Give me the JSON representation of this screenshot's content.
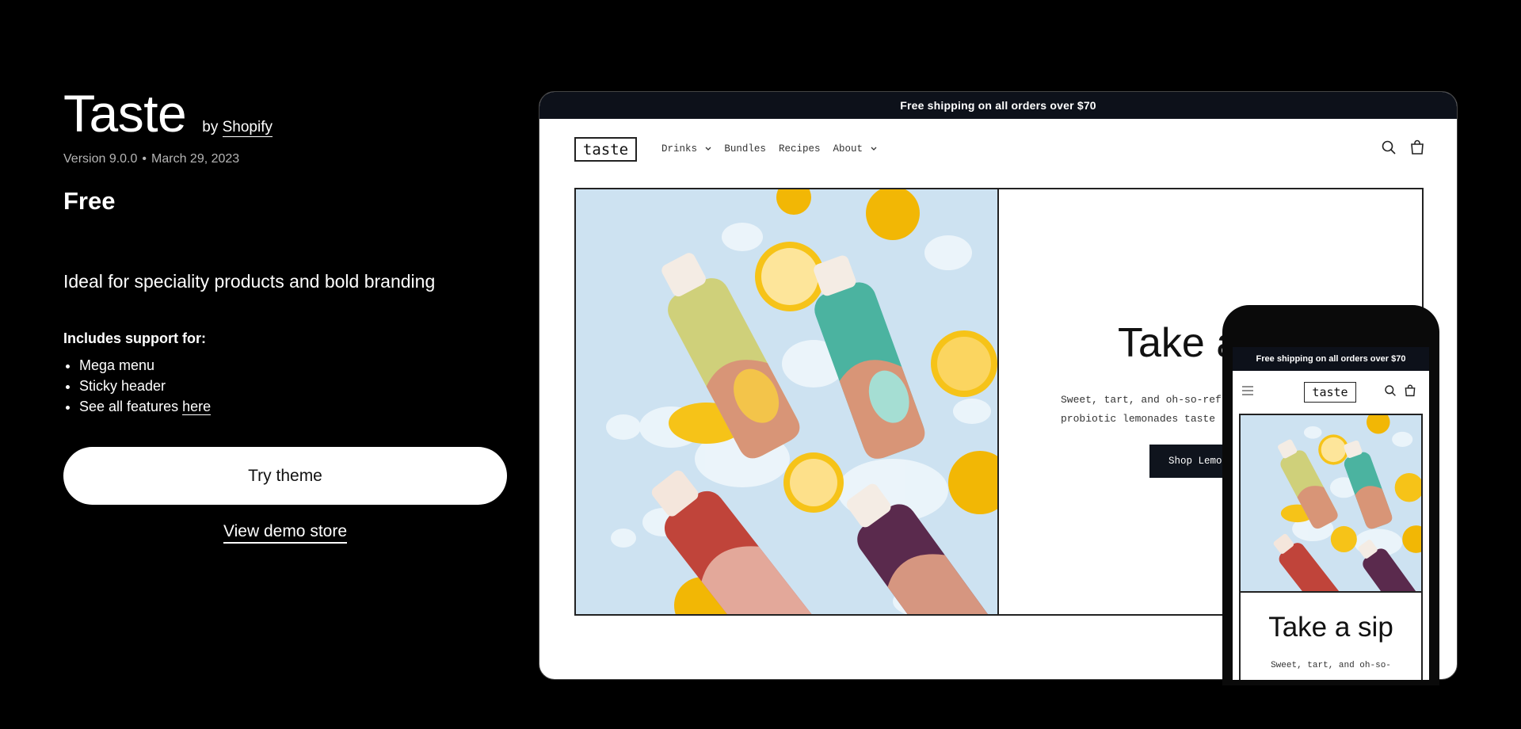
{
  "theme": {
    "name": "Taste",
    "by_prefix": "by",
    "by_link": "Shopify",
    "version": "Version 9.0.0",
    "date": "March 29, 2023",
    "dot": "•",
    "price": "Free",
    "tagline": "Ideal for speciality products and bold branding",
    "support_heading": "Includes support for:",
    "support_items": [
      "Mega menu",
      "Sticky header"
    ],
    "features_text": "See all features",
    "features_link": "here",
    "try_button": "Try theme",
    "demo_link": "View demo store"
  },
  "preview": {
    "announcement": "Free shipping on all orders over $70",
    "logo": "taste",
    "nav": [
      {
        "label": "Drinks",
        "has_dropdown": true
      },
      {
        "label": "Bundles",
        "has_dropdown": false
      },
      {
        "label": "Recipes",
        "has_dropdown": false
      },
      {
        "label": "About",
        "has_dropdown": true
      }
    ],
    "hero_title": "Take a",
    "hero_subtitle": "Sweet, tart, and oh-so-refr\nprobiotic lemonades taste l",
    "hero_cta": "Shop Lemon",
    "chevron": "⌄"
  },
  "mobile": {
    "announcement": "Free shipping on all orders over $70",
    "logo": "taste",
    "hero_title": "Take a sip",
    "hero_subtitle": "Sweet, tart, and oh-so-"
  },
  "colors": {
    "background": "#000000",
    "announcement_bar": "#0d111a",
    "button_dark": "#0f141d"
  },
  "icons": [
    "search-icon",
    "cart-icon",
    "menu-icon",
    "chevron-down-icon"
  ]
}
